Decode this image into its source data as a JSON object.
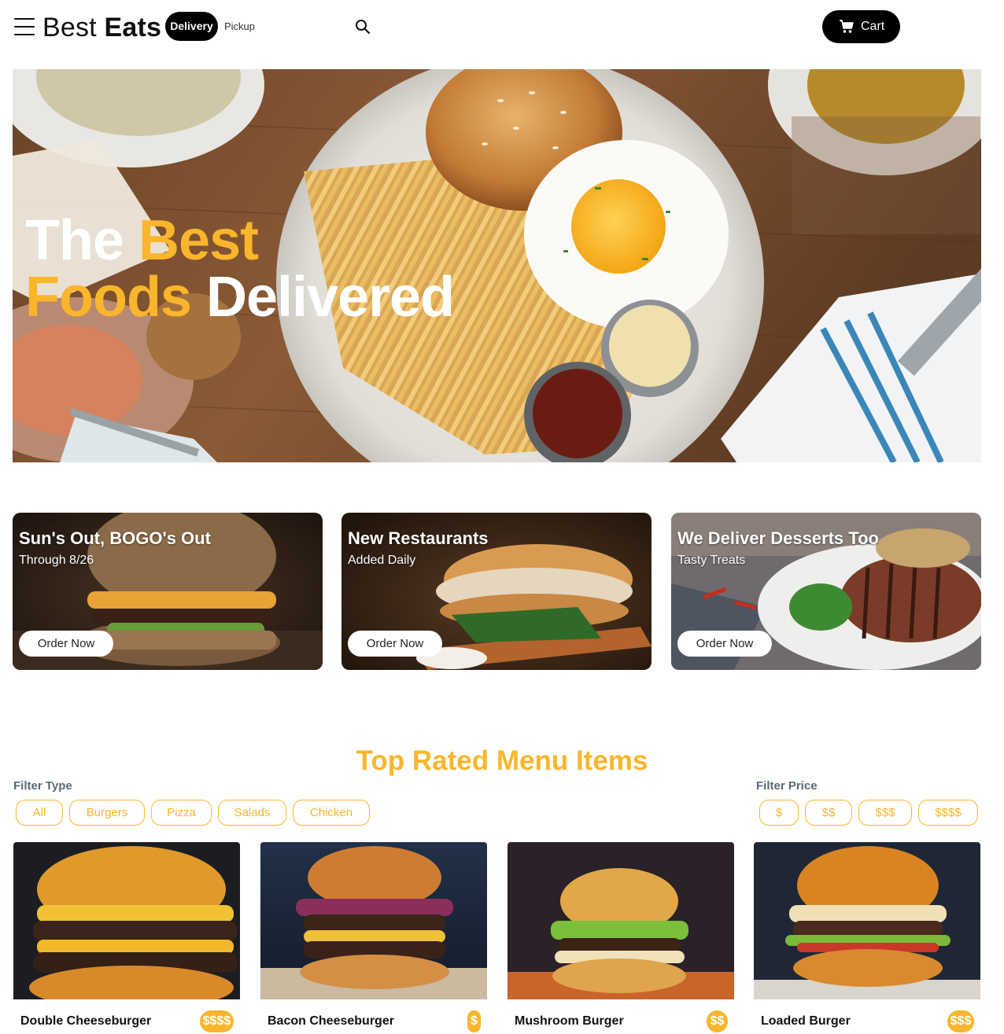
{
  "nav": {
    "logo_regular": "Best",
    "logo_bold": "Eats",
    "delivery_label": "Delivery",
    "pickup_label": "Pickup",
    "cart_label": "Cart"
  },
  "hero": {
    "line1_white": "The",
    "line1_accent": "Best",
    "line2_accent": "Foods",
    "line2_white": "Delivered"
  },
  "promos": [
    {
      "title": "Sun's Out, BOGO's Out",
      "subtitle": "Through 8/26",
      "button": "Order Now"
    },
    {
      "title": "New Restaurants",
      "subtitle": "Added Daily",
      "button": "Order Now"
    },
    {
      "title": "We Deliver Desserts Too",
      "subtitle": "Tasty Treats",
      "button": "Order Now"
    }
  ],
  "menu": {
    "title": "Top Rated Menu Items",
    "filter_type_label": "Filter Type",
    "filter_types": [
      "All",
      "Burgers",
      "Pizza",
      "Salads",
      "Chicken"
    ],
    "filter_price_label": "Filter Price",
    "filter_prices": [
      "$",
      "$$",
      "$$$",
      "$$$$"
    ],
    "items": [
      {
        "name": "Double Cheeseburger",
        "price": "$$$$"
      },
      {
        "name": "Bacon Cheeseburger",
        "price": "$"
      },
      {
        "name": "Mushroom Burger",
        "price": "$$"
      },
      {
        "name": "Loaded Burger",
        "price": "$$$"
      }
    ]
  },
  "colors": {
    "accent": "#f9b52b",
    "nav_pill": "#000000",
    "filter_label": "#5a6775"
  },
  "icons": [
    "hamburger-menu-icon",
    "search-icon",
    "cart-icon"
  ]
}
